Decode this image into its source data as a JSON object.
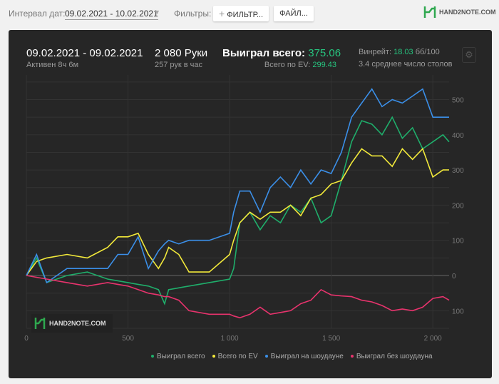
{
  "toolbar": {
    "interval_label": "Интервал дат:",
    "interval_value": "09.02.2021 - 10.02.2021",
    "filters_label": "Фильтры:",
    "filter_button": "ФИЛЬТР...",
    "file_button": "ФАЙЛ...",
    "logo": "HAND2NOTE.COM"
  },
  "summary": {
    "dates": "09.02.2021 - 09.02.2021",
    "active": "Активен 8ч 6м",
    "hands": "2 080 Руки",
    "hands_per_hour": "257 рук в час",
    "won_label": "Выиграл всего:",
    "won_value": "375.06",
    "ev_label": "Всего по EV:",
    "ev_value": "299.43",
    "winrate_label": "Винрейт:",
    "winrate_value": "18.03",
    "winrate_unit": "бб/100",
    "tables": "3.4 среднее число столов"
  },
  "watermark": "HAND2NOTE.COM",
  "chart_data": {
    "type": "line",
    "xlabel": "",
    "ylabel": "",
    "xlim": [
      0,
      2080
    ],
    "ylim": [
      -150,
      570
    ],
    "x_ticks": [
      0,
      500,
      1000,
      1500,
      2000
    ],
    "x_tick_labels": [
      "0",
      "500",
      "1 000",
      "1 500",
      "2 000"
    ],
    "y_ticks": [
      -100,
      0,
      100,
      200,
      300,
      400,
      500
    ],
    "y_tick_labels": [
      "100",
      "0",
      "100",
      "200",
      "300",
      "400",
      "500"
    ],
    "grid": true,
    "legend_position": "bottom-right",
    "x": [
      0,
      50,
      100,
      200,
      300,
      400,
      450,
      500,
      550,
      600,
      650,
      680,
      700,
      750,
      800,
      900,
      1000,
      1020,
      1050,
      1100,
      1150,
      1200,
      1250,
      1300,
      1350,
      1400,
      1450,
      1500,
      1550,
      1600,
      1650,
      1700,
      1750,
      1800,
      1850,
      1900,
      1950,
      2000,
      2050,
      2080
    ],
    "series": [
      {
        "name": "Выиграл всего",
        "color": "#1fae6b",
        "values": [
          0,
          50,
          -20,
          0,
          10,
          -10,
          -15,
          -20,
          -25,
          -30,
          -40,
          -80,
          -40,
          -35,
          -30,
          -20,
          -10,
          20,
          150,
          180,
          130,
          170,
          150,
          200,
          180,
          220,
          150,
          170,
          270,
          380,
          440,
          430,
          400,
          450,
          390,
          420,
          360,
          380,
          400,
          380
        ]
      },
      {
        "name": "Всего по EV",
        "color": "#f2e93a",
        "values": [
          0,
          40,
          50,
          60,
          50,
          80,
          110,
          110,
          120,
          60,
          20,
          50,
          80,
          60,
          10,
          10,
          60,
          100,
          150,
          180,
          160,
          180,
          180,
          200,
          170,
          220,
          230,
          260,
          270,
          320,
          360,
          340,
          340,
          310,
          360,
          330,
          360,
          280,
          300,
          300
        ]
      },
      {
        "name": "Выиграл на шоудауне",
        "color": "#3b8fe8",
        "values": [
          0,
          60,
          -20,
          20,
          20,
          20,
          60,
          60,
          110,
          20,
          70,
          90,
          100,
          90,
          100,
          100,
          120,
          180,
          240,
          240,
          180,
          250,
          280,
          250,
          300,
          260,
          300,
          290,
          350,
          450,
          490,
          530,
          480,
          500,
          490,
          510,
          530,
          450,
          450,
          450
        ]
      },
      {
        "name": "Выиграл без шоудауна",
        "color": "#e8336d",
        "values": [
          0,
          -5,
          -10,
          -20,
          -30,
          -20,
          -25,
          -30,
          -40,
          -50,
          -55,
          -60,
          -60,
          -70,
          -100,
          -110,
          -110,
          -115,
          -120,
          -110,
          -90,
          -110,
          -105,
          -100,
          -80,
          -70,
          -40,
          -55,
          -58,
          -60,
          -70,
          -75,
          -85,
          -100,
          -95,
          -100,
          -90,
          -65,
          -60,
          -70
        ]
      }
    ]
  }
}
